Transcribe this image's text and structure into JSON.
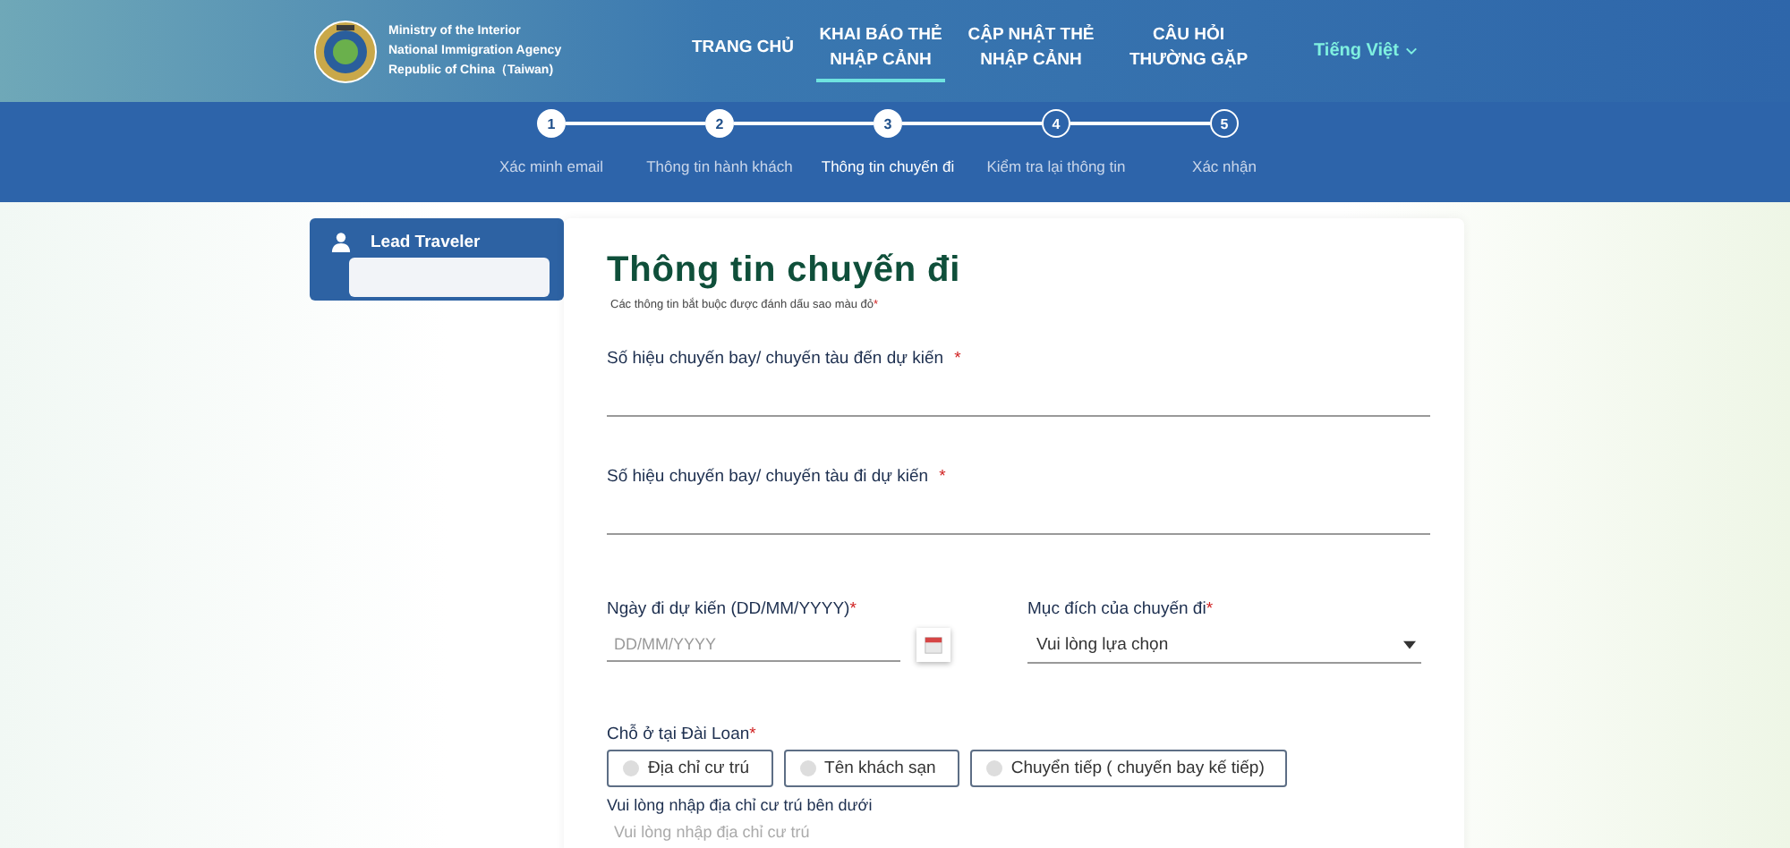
{
  "header": {
    "agency_lines": [
      "Ministry of the Interior",
      "National Immigration Agency",
      "Republic of China（Taiwan)"
    ],
    "nav": [
      {
        "label": "TRANG CHỦ",
        "selected": false
      },
      {
        "label": "KHAI BÁO THẺ NHẬP CẢNH",
        "selected": true
      },
      {
        "label": "CẬP NHẬT THẺ NHẬP CẢNH",
        "selected": false
      },
      {
        "label": "CÂU HỎI THƯỜNG GẶP",
        "selected": false
      }
    ],
    "language": "Tiếng Việt"
  },
  "steps": [
    {
      "number": "1",
      "label": "Xác minh email",
      "done": true,
      "selected": false
    },
    {
      "number": "2",
      "label": "Thông tin hành khách",
      "done": true,
      "selected": false
    },
    {
      "number": "3",
      "label": "Thông tin chuyến đi",
      "done": true,
      "selected": true
    },
    {
      "number": "4",
      "label": "Kiểm tra lại thông tin",
      "done": false,
      "selected": false
    },
    {
      "number": "5",
      "label": "Xác nhận",
      "done": false,
      "selected": false
    }
  ],
  "sidebar": {
    "title": "Lead Traveler"
  },
  "form": {
    "title": "Thông tin chuyến đi",
    "note": "Các thông tin bắt buộc được đánh dấu sao màu đỏ",
    "required_mark": "*",
    "arrival_flight": {
      "label": "Số hiệu chuyến bay/ chuyến tàu đến dự kiến",
      "required": true
    },
    "departure_flight": {
      "label": "Số hiệu chuyến bay/ chuyến tàu đi dự kiến",
      "required": true
    },
    "departure_date": {
      "label": "Ngày đi dự kiến (DD/MM/YYYY)",
      "required": true,
      "placeholder": "DD/MM/YYYY"
    },
    "purpose": {
      "label": "Mục đích của chuyến đi",
      "required": true,
      "value": "Vui lòng lựa chọn"
    },
    "stay": {
      "label": "Chỗ ở tại Đài Loan",
      "required": true,
      "options": [
        {
          "label": "Địa chỉ cư trú",
          "checked": false
        },
        {
          "label": "Tên khách sạn",
          "checked": false
        },
        {
          "label": "Chuyển tiếp ( chuyến bay kế tiếp)",
          "checked": false
        }
      ]
    },
    "address": {
      "label": "Vui lòng nhập địa chỉ cư trú bên dưới",
      "placeholder": "Vui lòng nhập địa chỉ cư trú"
    }
  }
}
